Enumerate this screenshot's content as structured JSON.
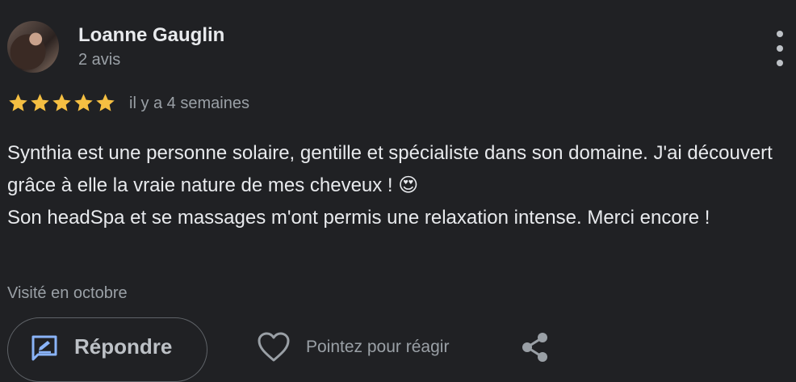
{
  "reviewer": {
    "name": "Loanne Gauglin",
    "reviews_count": "2 avis"
  },
  "rating": {
    "stars": 5,
    "max": 5,
    "color": "#f5bf42",
    "date": "il y a 4 semaines"
  },
  "review": {
    "text": "Synthia est une personne solaire, gentille et spécialiste dans son domaine. J'ai découvert grâce à elle la vraie nature de mes cheveux ! 😍\nSon headSpa et se massages m'ont permis une relaxation intense. Merci encore !"
  },
  "visit": "Visité en octobre",
  "actions": {
    "reply_label": "Répondre",
    "react_label": "Pointez pour réagir",
    "reply_icon": "reply-edit-icon",
    "react_icon": "heart-icon",
    "share_icon": "share-icon",
    "more_icon": "more-vert-icon"
  },
  "colors": {
    "background": "#202124",
    "text_primary": "#e8eaed",
    "text_secondary": "#9aa0a6",
    "accent_blue": "#8ab4f8"
  }
}
